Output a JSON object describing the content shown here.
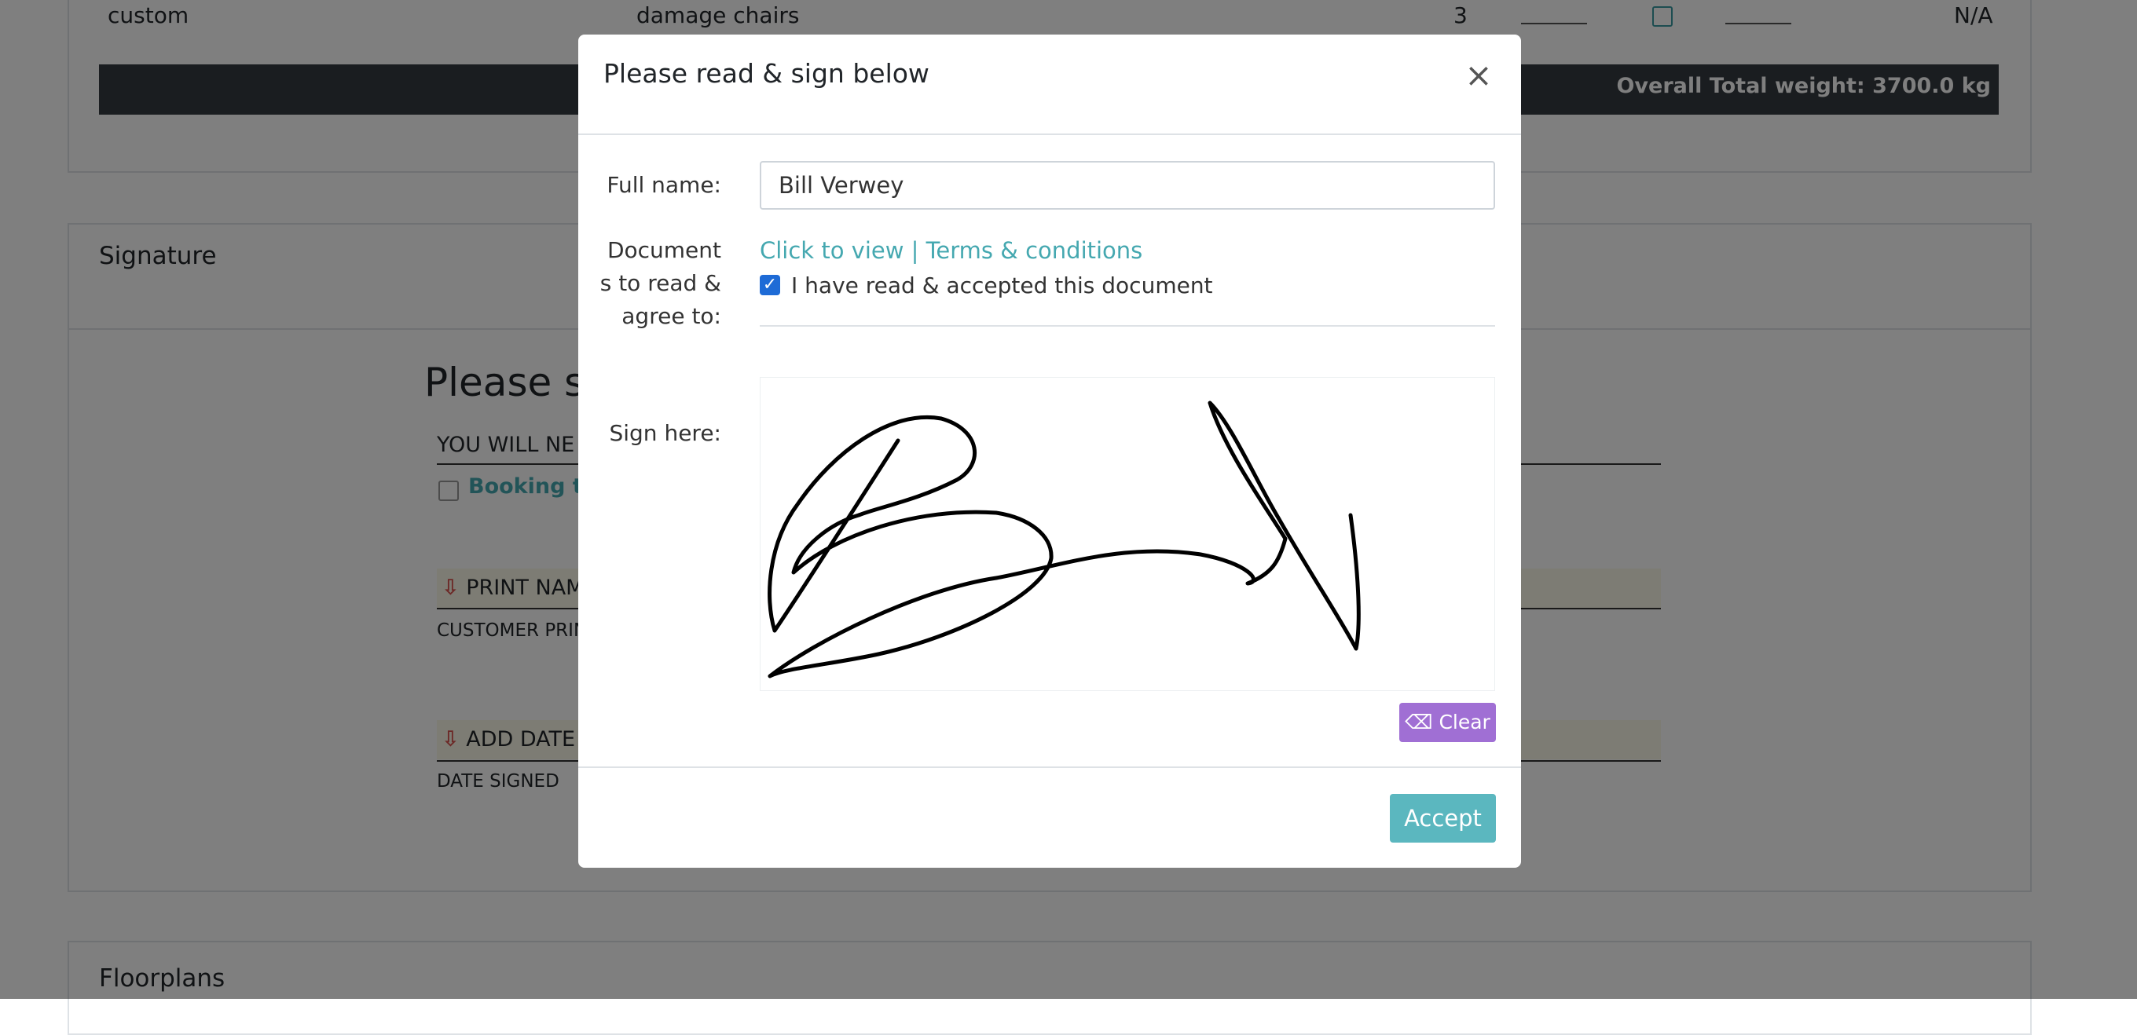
{
  "background": {
    "table_row": {
      "col1": "custom",
      "col2": "damage chairs",
      "qty": "3",
      "value": "N/A"
    },
    "total_label": "Overall Total weight: 3700.0 kg",
    "signature_card_title": "Signature",
    "signature_heading": "Please si",
    "notice_text": "YOU WILL NE",
    "booking_terms_text": "Booking te",
    "print_name_text": "PRINT NAM",
    "customer_print_label": "CUSTOMER PRIN",
    "add_date_text": "ADD DATE",
    "date_signed_label": "DATE SIGNED",
    "floorplans_title": "Floorplans",
    "arrow_glyph": "⇩"
  },
  "modal": {
    "title": "Please read & sign below",
    "close_glyph": "×",
    "full_name_label": "Full name:",
    "full_name_value": "Bill Verwey",
    "documents_label_line1": "Document",
    "documents_label_line2": "s to read &",
    "documents_label_line3": "agree to:",
    "doc_link_text": "Click to view | Terms & conditions",
    "accepted_label": "I have read & accepted this document",
    "accepted_checked": true,
    "check_glyph": "✓",
    "sign_here_label": "Sign here:",
    "clear_label": "Clear",
    "eraser_glyph": "⌫",
    "accept_label": "Accept"
  },
  "colors": {
    "link": "#45a8b0",
    "accept_button": "#5bb7bf",
    "clear_button": "#a06fd4",
    "checkbox": "#1e6bd6",
    "total_bar": "#343a40"
  }
}
